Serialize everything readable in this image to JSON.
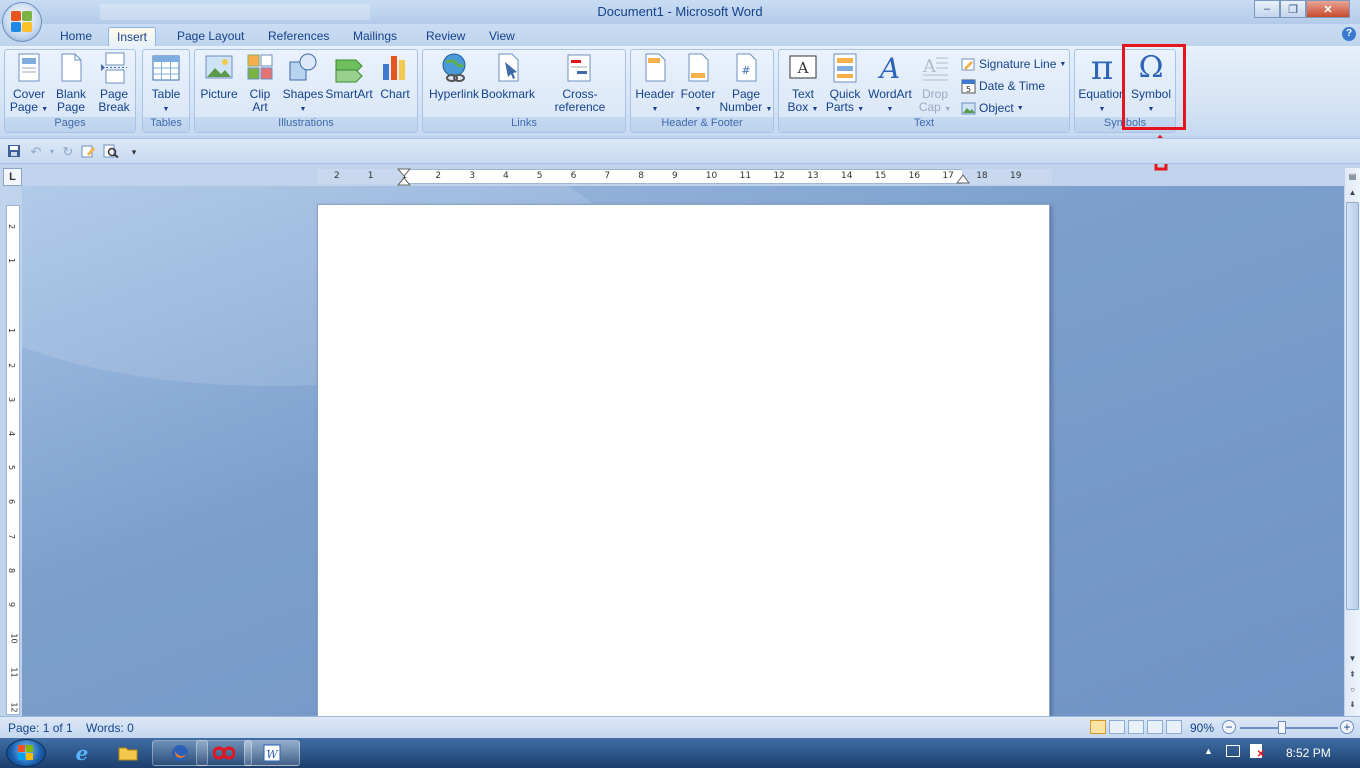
{
  "window": {
    "title": "Document1 - Microsoft Word",
    "controls": {
      "minimize": "‒",
      "restore": "❐",
      "close": "✕"
    }
  },
  "tabs": [
    {
      "label": "Home"
    },
    {
      "label": "Insert"
    },
    {
      "label": "Page Layout"
    },
    {
      "label": "References"
    },
    {
      "label": "Mailings"
    },
    {
      "label": "Review"
    },
    {
      "label": "View"
    }
  ],
  "active_tab": "Insert",
  "ribbon": {
    "groups": {
      "pages": "Pages",
      "tables": "Tables",
      "illustrations": "Illustrations",
      "links": "Links",
      "header_footer": "Header & Footer",
      "text": "Text",
      "symbols": "Symbols"
    },
    "buttons": {
      "cover_page": [
        "Cover",
        "Page"
      ],
      "blank_page": [
        "Blank",
        "Page"
      ],
      "page_break": [
        "Page",
        "Break"
      ],
      "table": "Table",
      "picture": "Picture",
      "clip_art": [
        "Clip",
        "Art"
      ],
      "shapes": "Shapes",
      "smartart": "SmartArt",
      "chart": "Chart",
      "hyperlink": "Hyperlink",
      "bookmark": "Bookmark",
      "cross_reference": "Cross-reference",
      "header": "Header",
      "footer": "Footer",
      "page_number": [
        "Page",
        "Number"
      ],
      "text_box": [
        "Text",
        "Box"
      ],
      "quick_parts": [
        "Quick",
        "Parts"
      ],
      "wordart": "WordArt",
      "drop_cap": [
        "Drop",
        "Cap"
      ],
      "signature_line": "Signature Line",
      "date_time": "Date & Time",
      "object": "Object",
      "equation": "Equation",
      "symbol": "Symbol"
    }
  },
  "ruler": {
    "h_numbers": [
      "2",
      "1",
      "1",
      "2",
      "3",
      "4",
      "5",
      "6",
      "7",
      "8",
      "9",
      "10",
      "11",
      "12",
      "13",
      "14",
      "15",
      "16",
      "17",
      "18",
      "19"
    ],
    "v_numbers": [
      "2",
      "1",
      "1",
      "2",
      "3",
      "4",
      "5",
      "6",
      "7",
      "8",
      "9",
      "10",
      "11",
      "12"
    ]
  },
  "status": {
    "page": "Page: 1 of 1",
    "words": "Words: 0",
    "zoom": "90%"
  },
  "taskbar": {
    "time": "8:52 PM"
  },
  "annotation": {
    "color": "#e4151c"
  },
  "colors": {
    "ribbon_text": "#15428b",
    "accent": "#3e6aaa"
  }
}
